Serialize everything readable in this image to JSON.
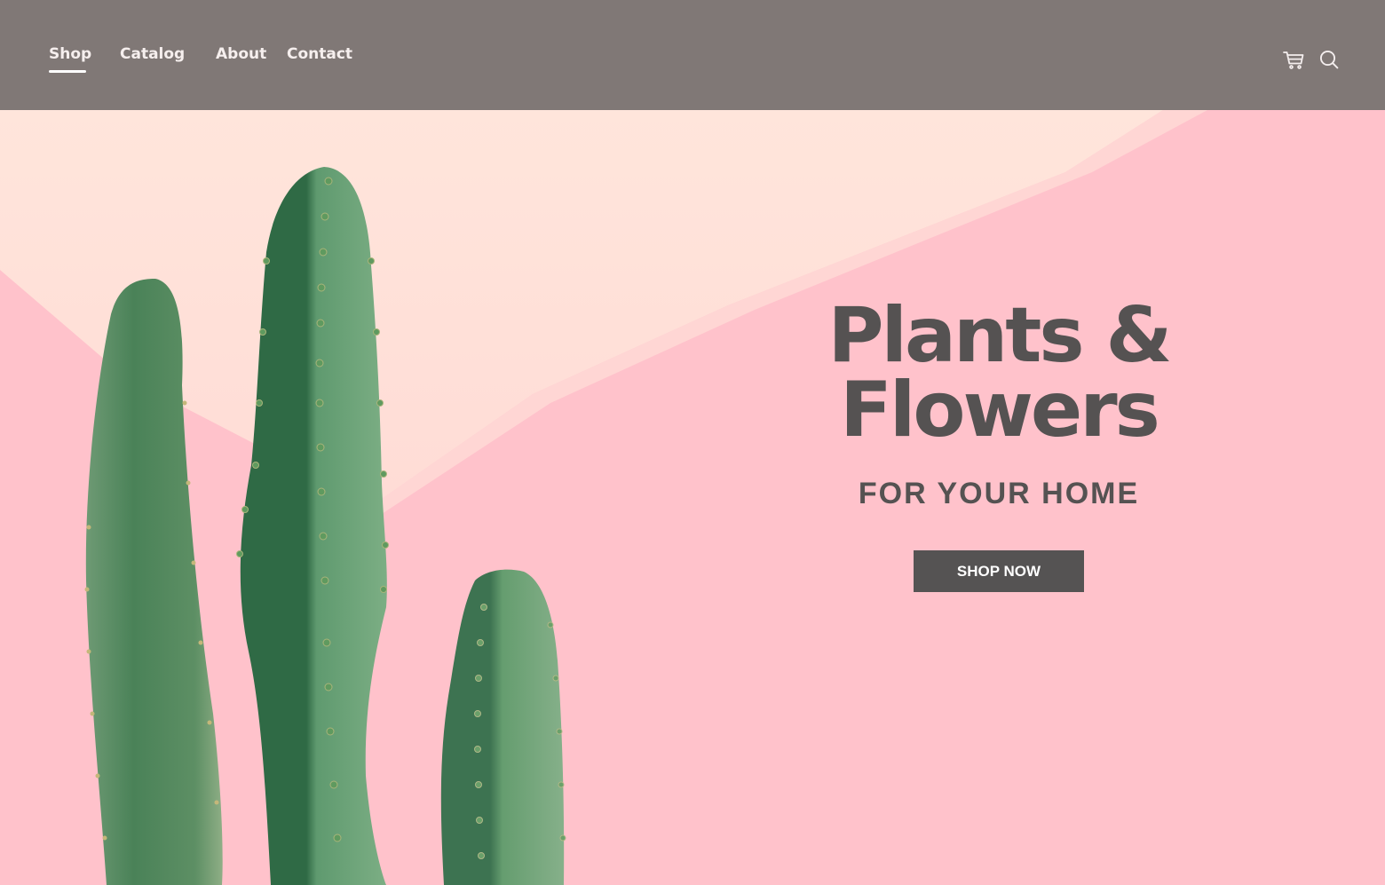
{
  "nav": {
    "items": [
      {
        "label": "Shop",
        "active": true
      },
      {
        "label": "Catalog",
        "active": false
      },
      {
        "label": "About",
        "active": false
      },
      {
        "label": "Contact",
        "active": false
      }
    ],
    "icons": [
      "cart-icon",
      "search-icon"
    ]
  },
  "hero": {
    "title_line1": "Plants &",
    "title_line2": "Flowers",
    "subtitle": "FOR YOUR HOME",
    "cta_label": "SHOP NOW"
  },
  "colors": {
    "header_bg": "#807876",
    "hero_pink": "#ffc3cc",
    "hero_light": "#ffe4da",
    "cactus_green": "#4e8b60",
    "text_dark": "#555252",
    "button_bg": "#555353"
  }
}
